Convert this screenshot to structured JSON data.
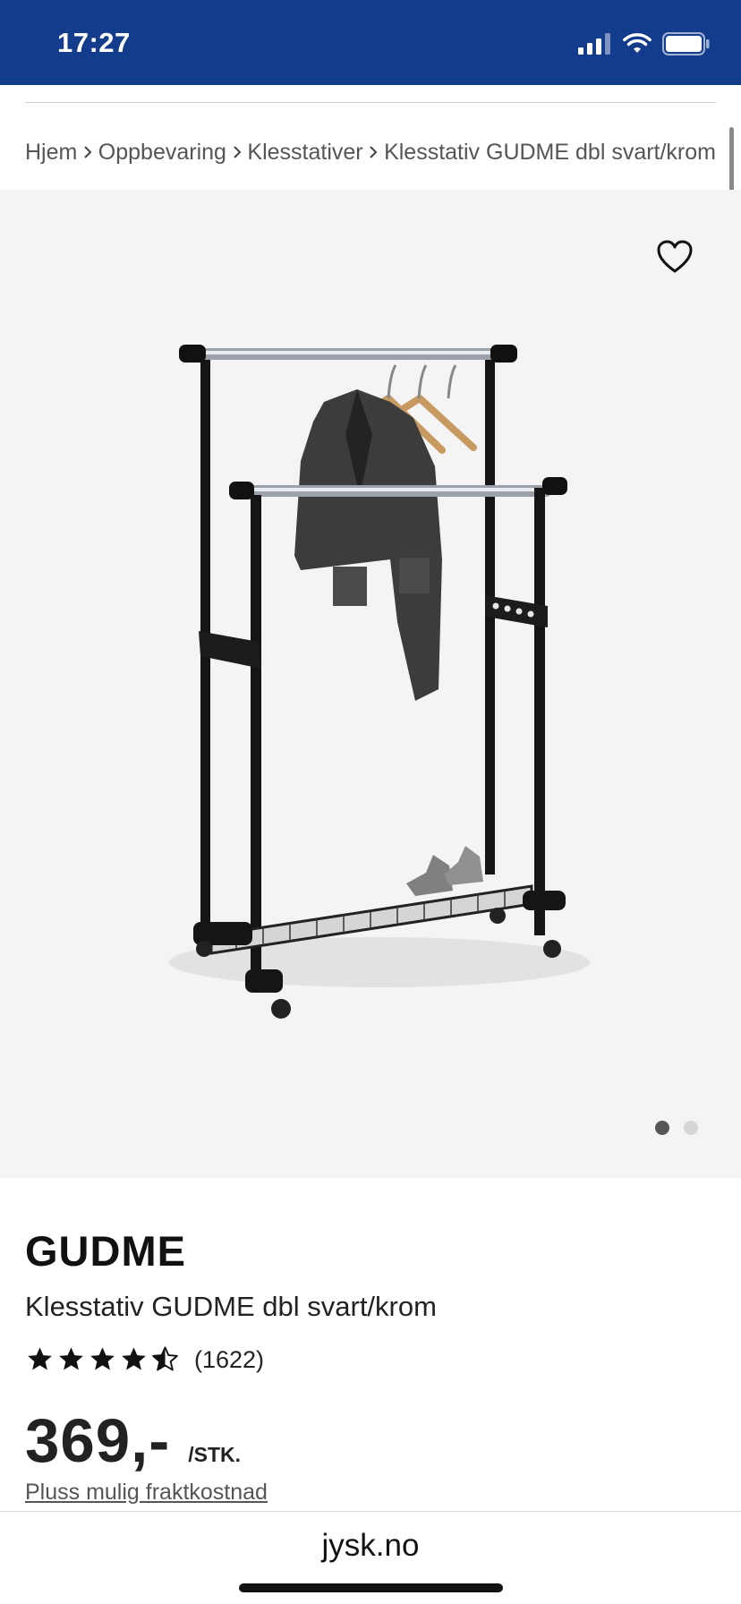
{
  "status_bar": {
    "time": "17:27",
    "background_color": "#143c8c",
    "icons": [
      "cellular-signal-icon",
      "wifi-icon",
      "battery-icon"
    ]
  },
  "breadcrumb": {
    "items": [
      "Hjem",
      "Oppbevaring",
      "Klesstativer",
      "Klesstativ GUDME dbl svart/krom"
    ],
    "separator_icon": "chevron-right-icon"
  },
  "gallery": {
    "favorite_icon": "heart-outline-icon",
    "image_subject": "klesstativ-photo",
    "slide_count": 2,
    "active_slide": 1
  },
  "product": {
    "brand": "GUDME",
    "name": "Klesstativ GUDME dbl svart/krom",
    "rating": 4.5,
    "rating_max": 5,
    "rating_count": "(1622)",
    "price": "369,-",
    "unit": "/STK.",
    "shipping_note": "Pluss mulig fraktkostnad"
  },
  "browser": {
    "domain": "jysk.no"
  }
}
